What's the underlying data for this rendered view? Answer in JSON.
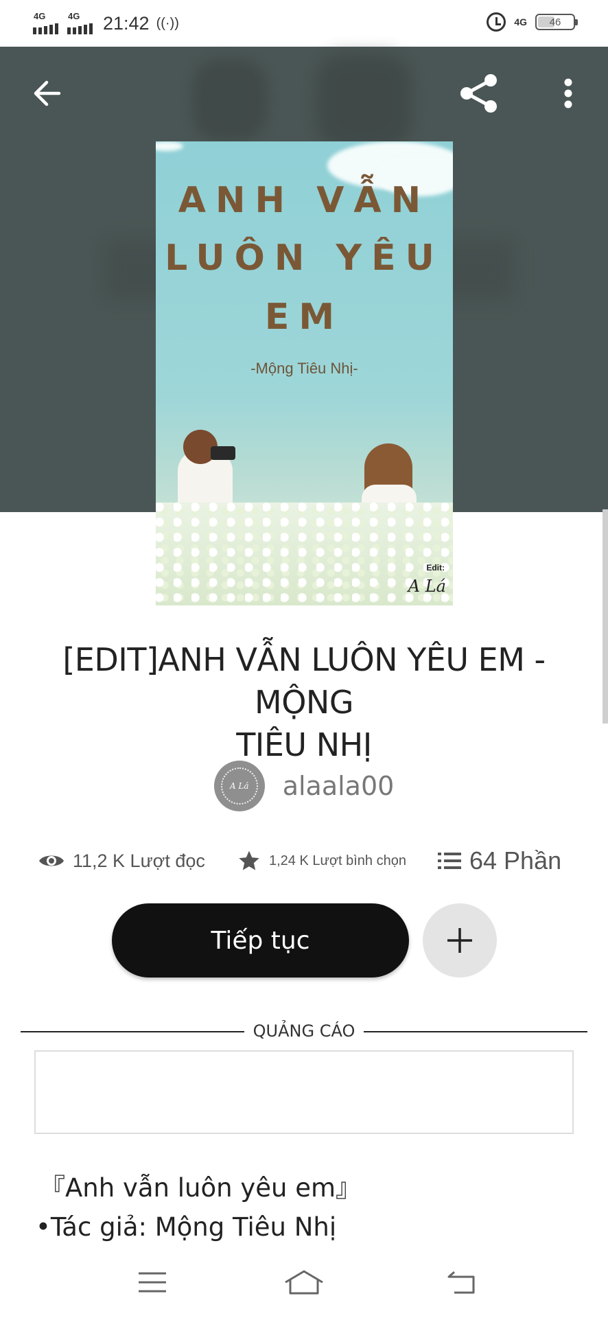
{
  "status_bar": {
    "sim1_network": "4G",
    "sim2_network": "4G",
    "time": "21:42",
    "hotspot_glyph": "((·))",
    "right_network": "4G",
    "battery_level": "46"
  },
  "header": {
    "back_icon": "arrow-left-icon",
    "share_icon": "share-icon",
    "more_icon": "more-vertical-icon"
  },
  "cover": {
    "line1": "ANH VẪN",
    "line2": "LUÔN YÊU",
    "line3": "EM",
    "author": "-Mộng Tiêu Nhị-",
    "edit_tag": "Edit:",
    "edit_signature": "A Lá"
  },
  "book": {
    "title_line1": "[EDIT]ANH VẪN LUÔN YÊU EM - MỘNG",
    "title_line2": "TIÊU NHỊ",
    "author_avatar_text": "A Lá",
    "author_name": "alaala00"
  },
  "stats": {
    "reads": "11,2 K Lượt đọc",
    "votes": "1,24 K Lượt bình chọn",
    "parts": "64 Phần"
  },
  "actions": {
    "continue_label": "Tiếp tục",
    "add_icon": "plus-icon"
  },
  "ad": {
    "label": "QUẢNG CÁO"
  },
  "description": {
    "line1": "『Anh vẫn luôn yêu em』",
    "line2": "•Tác giả: Mộng Tiêu Nhị"
  },
  "nav": {
    "menu_icon": "menu-icon",
    "home_icon": "home-icon",
    "back_icon": "nav-back-icon"
  }
}
